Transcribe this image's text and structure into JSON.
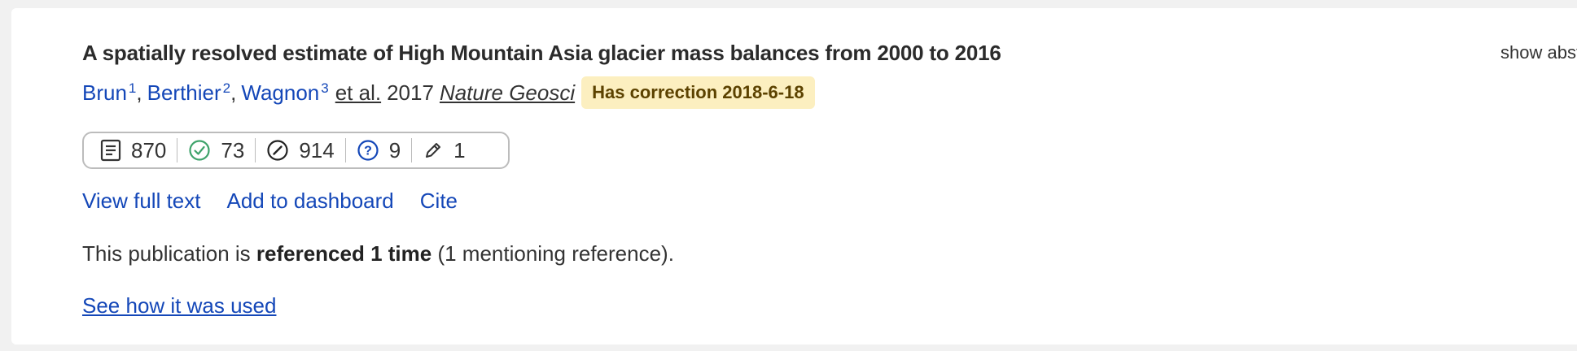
{
  "publication": {
    "title": "A spatially resolved estimate of High Mountain Asia glacier mass balances from 2000 to 2016",
    "show_abstract_label": "show abstract",
    "authors": [
      {
        "name": "Brun",
        "affiliation": "1"
      },
      {
        "name": "Berthier",
        "affiliation": "2"
      },
      {
        "name": "Wagnon",
        "affiliation": "3"
      }
    ],
    "author_separator": ",",
    "et_al": "et al.",
    "year": "2017",
    "journal": "Nature Geosci",
    "correction_badge": "Has correction 2018-6-18"
  },
  "stats": [
    {
      "icon": "document-icon",
      "value": "870"
    },
    {
      "icon": "check-circle-icon",
      "value": "73",
      "color": "#3fa36b"
    },
    {
      "icon": "slash-circle-icon",
      "value": "914"
    },
    {
      "icon": "question-circle-icon",
      "value": "9",
      "color": "#1447b8"
    },
    {
      "icon": "pencil-icon",
      "value": "1"
    }
  ],
  "actions": {
    "view_full_text": "View full text",
    "add_to_dashboard": "Add to dashboard",
    "cite": "Cite"
  },
  "references": {
    "prefix": "This publication is ",
    "bold": "referenced 1 time",
    "suffix": " (1 mentioning reference)."
  },
  "see_how_used": "See how it was used",
  "colors": {
    "link": "#1447b8",
    "badge_bg": "#fcefc0",
    "badge_text": "#5c4200"
  }
}
